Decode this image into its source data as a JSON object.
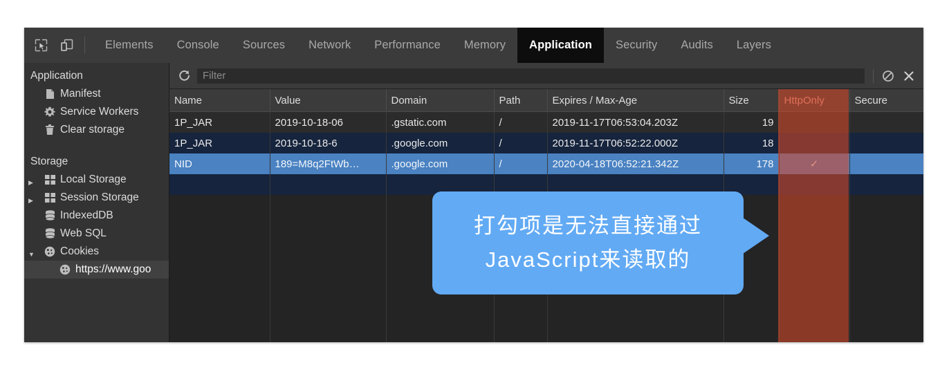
{
  "window": {
    "title": "Chrome DevTools — Application panel"
  },
  "tabbar": {
    "icons": [
      {
        "name": "inspect-element-icon",
        "label": "Inspect element"
      },
      {
        "name": "device-toolbar-icon",
        "label": "Toggle device toolbar"
      }
    ],
    "tabs": [
      {
        "label": "Elements",
        "selected": false
      },
      {
        "label": "Console",
        "selected": false
      },
      {
        "label": "Sources",
        "selected": false
      },
      {
        "label": "Network",
        "selected": false
      },
      {
        "label": "Performance",
        "selected": false
      },
      {
        "label": "Memory",
        "selected": false
      },
      {
        "label": "Application",
        "selected": true
      },
      {
        "label": "Security",
        "selected": false
      },
      {
        "label": "Audits",
        "selected": false
      },
      {
        "label": "Layers",
        "selected": false
      }
    ]
  },
  "sidebar": {
    "sections": [
      {
        "title": "Application",
        "items": [
          {
            "label": "Manifest",
            "icon": "document-icon",
            "expandable": false,
            "expanded": false,
            "selected": false,
            "indent": 1
          },
          {
            "label": "Service Workers",
            "icon": "gear-icon",
            "expandable": false,
            "expanded": false,
            "selected": false,
            "indent": 1
          },
          {
            "label": "Clear storage",
            "icon": "trash-icon",
            "expandable": false,
            "expanded": false,
            "selected": false,
            "indent": 1
          }
        ]
      },
      {
        "title": "Storage",
        "items": [
          {
            "label": "Local Storage",
            "icon": "table-grid-icon",
            "expandable": true,
            "expanded": false,
            "selected": false,
            "indent": 1
          },
          {
            "label": "Session Storage",
            "icon": "table-grid-icon",
            "expandable": true,
            "expanded": false,
            "selected": false,
            "indent": 1
          },
          {
            "label": "IndexedDB",
            "icon": "database-icon",
            "expandable": false,
            "expanded": false,
            "selected": false,
            "indent": 1
          },
          {
            "label": "Web SQL",
            "icon": "database-icon",
            "expandable": false,
            "expanded": false,
            "selected": false,
            "indent": 1
          },
          {
            "label": "Cookies",
            "icon": "cookie-icon",
            "expandable": true,
            "expanded": true,
            "selected": false,
            "indent": 1
          },
          {
            "label": "https://www.goo",
            "icon": "cookie-icon",
            "expandable": false,
            "expanded": false,
            "selected": true,
            "indent": 2
          }
        ]
      }
    ]
  },
  "toolbar": {
    "refresh_icon": "refresh-icon",
    "filter_placeholder": "Filter",
    "filter_value": "",
    "clear_icon": "block-clear-icon",
    "close_icon": "close-x-icon"
  },
  "table": {
    "columns": [
      {
        "key": "name",
        "label": "Name",
        "align": "left",
        "highlighted": false
      },
      {
        "key": "value",
        "label": "Value",
        "align": "left",
        "highlighted": false
      },
      {
        "key": "domain",
        "label": "Domain",
        "align": "left",
        "highlighted": false
      },
      {
        "key": "path",
        "label": "Path",
        "align": "left",
        "highlighted": false
      },
      {
        "key": "expires",
        "label": "Expires / Max-Age",
        "align": "left",
        "highlighted": false
      },
      {
        "key": "size",
        "label": "Size",
        "align": "right",
        "highlighted": false
      },
      {
        "key": "httponly",
        "label": "HttpOnly",
        "align": "center",
        "highlighted": true
      },
      {
        "key": "secure",
        "label": "Secure",
        "align": "left",
        "highlighted": false
      }
    ],
    "rows": [
      {
        "state": "normal",
        "name": "1P_JAR",
        "value": "2019-10-18-06",
        "domain": ".gstatic.com",
        "path": "/",
        "expires": "2019-11-17T06:53:04.203Z",
        "size": "19",
        "httponly": "",
        "secure": ""
      },
      {
        "state": "alt",
        "name": "1P_JAR",
        "value": "2019-10-18-6",
        "domain": ".google.com",
        "path": "/",
        "expires": "2019-11-17T06:52:22.000Z",
        "size": "18",
        "httponly": "",
        "secure": ""
      },
      {
        "state": "selected",
        "name": "NID",
        "value": "189=M8q2FtWb…",
        "domain": ".google.com",
        "path": "/",
        "expires": "2020-04-18T06:52:21.342Z",
        "size": "178",
        "httponly": "✓",
        "secure": ""
      },
      {
        "state": "empty",
        "name": "",
        "value": "",
        "domain": "",
        "path": "",
        "expires": "",
        "size": "",
        "httponly": "",
        "secure": ""
      }
    ]
  },
  "callout": {
    "line1": "打勾项是无法直接通过",
    "line2": "JavaScript来读取的",
    "color": "#62aaf4",
    "text_color": "#ffffff",
    "points_to": "HttpOnly"
  },
  "colors": {
    "panel_bg": "#242424",
    "toolbar_bg": "#3b3b3b",
    "sidebar_bg": "#333333",
    "selected_tab_bg": "#0d0d0d",
    "row_selected": "#4a82c2",
    "row_alt": "#16243d",
    "httponly_highlight": "#d6482a",
    "callout_blue": "#62aaf4"
  }
}
